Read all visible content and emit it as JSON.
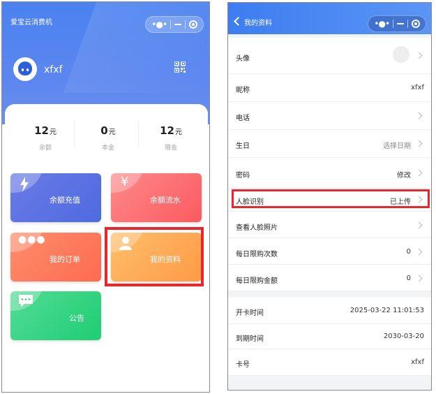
{
  "left": {
    "app_title": "爱宝云消费机",
    "username": "xfxf",
    "stats": [
      {
        "value": "12",
        "unit": "元",
        "label": "余额"
      },
      {
        "value": "0",
        "unit": "元",
        "label": "本金"
      },
      {
        "value": "12",
        "unit": "元",
        "label": "赠金"
      }
    ],
    "tiles": [
      {
        "label": "余额充值",
        "icon": "lightning-icon",
        "color": "#6d7ce8"
      },
      {
        "label": "余额流水",
        "icon": "yen-icon",
        "color": "#fb6d6e"
      },
      {
        "label": "我的订单",
        "icon": "more-dots-icon",
        "color": "#fe7a60"
      },
      {
        "label": "我的资料",
        "icon": "user-icon",
        "color": "#feab58"
      },
      {
        "label": "公告",
        "icon": "message-icon",
        "color": "#33d17f"
      }
    ]
  },
  "right": {
    "header_title": "我的资料",
    "rows": [
      {
        "label": "头像",
        "value": ""
      },
      {
        "label": "昵称",
        "value": "xfxf"
      },
      {
        "label": "电话",
        "value": ""
      },
      {
        "label": "生日",
        "value": "选择日期"
      },
      {
        "label": "密码",
        "value": "修改"
      },
      {
        "label": "人脸识别",
        "value": "已上传"
      },
      {
        "label": "查看人脸照片",
        "value": ""
      },
      {
        "label": "每日限购次数",
        "value": "0"
      },
      {
        "label": "每日限购金额",
        "value": "0"
      },
      {
        "label": "开卡时间",
        "value": "2025-03-22 11:01:53"
      },
      {
        "label": "到期时间",
        "value": "2030-03-20"
      },
      {
        "label": "卡号",
        "value": "xfxf"
      }
    ]
  },
  "colors": {
    "accent_blue": "#4a82f0",
    "highlight_red": "#e8262b"
  }
}
